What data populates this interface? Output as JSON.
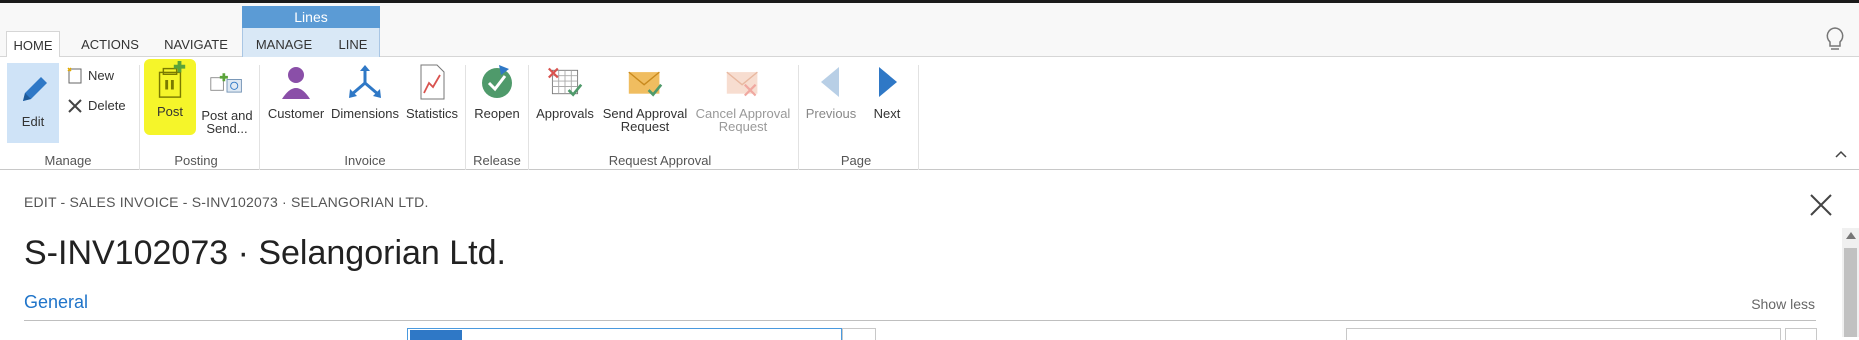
{
  "contextual_tab": {
    "title": "Lines"
  },
  "tabs": [
    {
      "label": "HOME"
    },
    {
      "label": "ACTIONS"
    },
    {
      "label": "NAVIGATE"
    },
    {
      "label": "MANAGE"
    },
    {
      "label": "LINE"
    }
  ],
  "ribbon": {
    "edit": "Edit",
    "new": "New",
    "delete": "Delete",
    "post": "Post",
    "post_and_send_1": "Post and",
    "post_and_send_2": "Send...",
    "customer": "Customer",
    "dimensions": "Dimensions",
    "statistics": "Statistics",
    "reopen": "Reopen",
    "approvals": "Approvals",
    "send_approval_1": "Send Approval",
    "send_approval_2": "Request",
    "cancel_approval_1": "Cancel Approval",
    "cancel_approval_2": "Request",
    "previous": "Previous",
    "next": "Next",
    "groups": {
      "manage": "Manage",
      "posting": "Posting",
      "invoice": "Invoice",
      "release": "Release",
      "request_approval": "Request Approval",
      "page": "Page"
    }
  },
  "page": {
    "breadcrumb": "EDIT - SALES INVOICE - S-INV102073 · SELANGORIAN LTD.",
    "title": "S-INV102073 · Selangorian Ltd.",
    "section": "General",
    "show_less": "Show less"
  },
  "colors": {
    "accent": "#1f74c9",
    "highlight": "#f5f52a",
    "contextual": "#5b9bd5"
  }
}
